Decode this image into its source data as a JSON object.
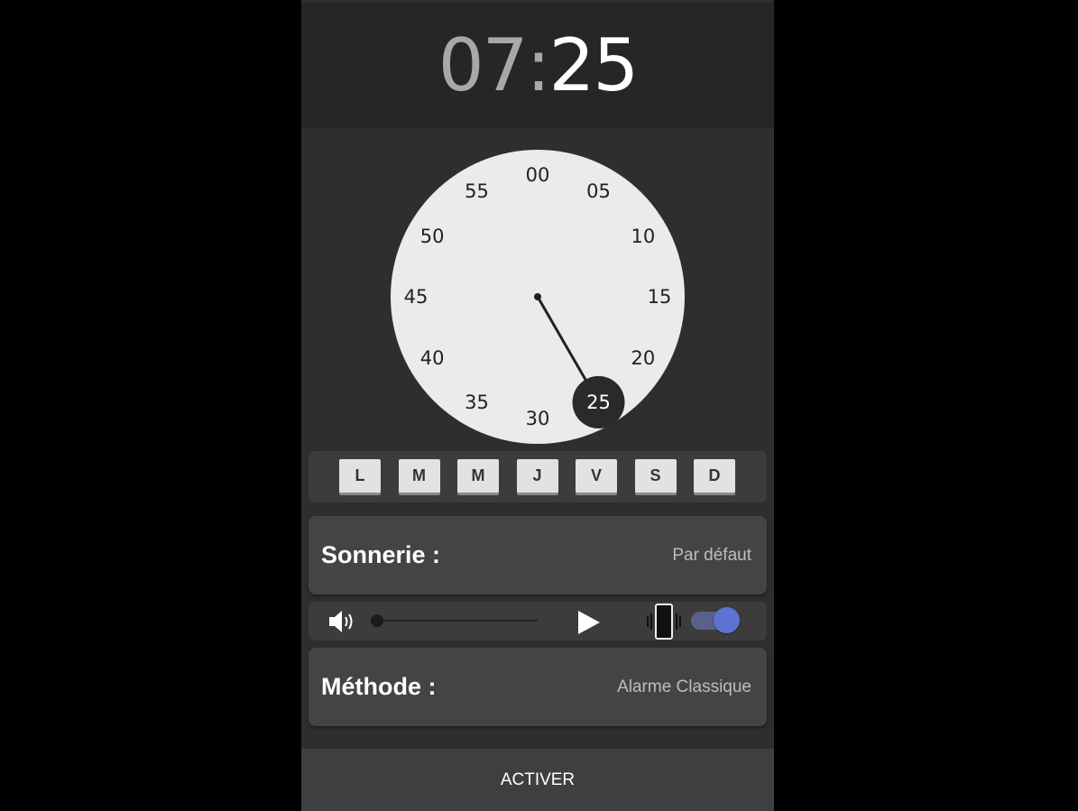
{
  "time": {
    "hours": "07",
    "separator": ":",
    "minutes": "25"
  },
  "dial": {
    "mode": "minutes",
    "numbers": [
      "00",
      "05",
      "10",
      "15",
      "20",
      "25",
      "30",
      "35",
      "40",
      "45",
      "50",
      "55"
    ],
    "selected": "25"
  },
  "days": [
    "L",
    "M",
    "M",
    "J",
    "V",
    "S",
    "D"
  ],
  "ringtone": {
    "label": "Sonnerie :",
    "value": "Par défaut"
  },
  "volume": {
    "icon": "speaker-icon",
    "level": 0
  },
  "play": {
    "icon": "play-icon"
  },
  "vibration": {
    "icon": "vibrate-phone-icon",
    "enabled": true
  },
  "method": {
    "label": "Méthode :",
    "value": "Alarme Classique"
  },
  "action": {
    "label": "ACTIVER"
  },
  "colors": {
    "background": "#2e2e2e",
    "header": "#262626",
    "card": "#444444",
    "dial_face": "#ebebeb",
    "selection": "#2a2a2a",
    "toggle_accent": "#5c73d2"
  }
}
